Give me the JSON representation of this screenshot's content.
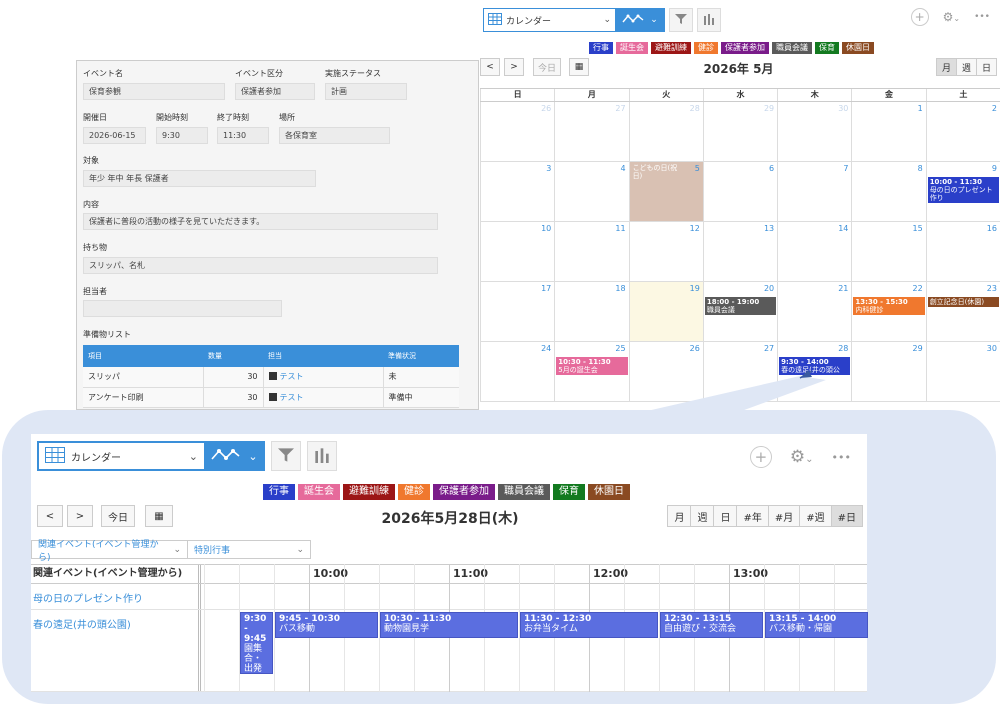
{
  "toolbar": {
    "view_label": "カレンダー",
    "caret": "⌄",
    "graph_icon": "∿∿",
    "filter_icon": "filter-icon",
    "chart_icon": "bar-chart-icon",
    "plus": "+",
    "gear": "⚙",
    "gear_caret": "⌄",
    "more": "•••"
  },
  "legend": [
    {
      "label": "行事",
      "color": "#2a3fc9"
    },
    {
      "label": "誕生会",
      "color": "#e66a9b"
    },
    {
      "label": "避難訓練",
      "color": "#9c1616"
    },
    {
      "label": "健診",
      "color": "#f0782e"
    },
    {
      "label": "保護者参加",
      "color": "#7a1c8a"
    },
    {
      "label": "職員会議",
      "color": "#5a5a5a"
    },
    {
      "label": "保育",
      "color": "#137a20"
    },
    {
      "label": "休園日",
      "color": "#8a4a22"
    }
  ],
  "month_view": {
    "prev": "<",
    "next": ">",
    "today": "今日",
    "calendar_icon": "▦",
    "title": "2026年 5月",
    "modes": [
      "月",
      "週",
      "日"
    ],
    "weekdays": [
      "日",
      "月",
      "火",
      "水",
      "木",
      "金",
      "土"
    ],
    "weeks": [
      [
        {
          "n": "26",
          "o": true
        },
        {
          "n": "27",
          "o": true
        },
        {
          "n": "28",
          "o": true
        },
        {
          "n": "29",
          "o": true
        },
        {
          "n": "30",
          "o": true
        },
        {
          "n": "1"
        },
        {
          "n": "2"
        }
      ],
      [
        {
          "n": "3"
        },
        {
          "n": "4"
        },
        {
          "n": "5",
          "holiday": true
        },
        {
          "n": "6"
        },
        {
          "n": "7"
        },
        {
          "n": "8"
        },
        {
          "n": "9"
        }
      ],
      [
        {
          "n": "10"
        },
        {
          "n": "11"
        },
        {
          "n": "12"
        },
        {
          "n": "13"
        },
        {
          "n": "14"
        },
        {
          "n": "15"
        },
        {
          "n": "16"
        }
      ],
      [
        {
          "n": "17"
        },
        {
          "n": "18"
        },
        {
          "n": "19",
          "today": true
        },
        {
          "n": "20"
        },
        {
          "n": "21"
        },
        {
          "n": "22"
        },
        {
          "n": "23"
        }
      ],
      [
        {
          "n": "24"
        },
        {
          "n": "25"
        },
        {
          "n": "26"
        },
        {
          "n": "27"
        },
        {
          "n": "28"
        },
        {
          "n": "29"
        },
        {
          "n": "30"
        }
      ]
    ],
    "events": [
      {
        "week": 1,
        "day": 2,
        "time": "",
        "title": "こどもの日(祝日)",
        "color": "transparent",
        "text": "#fff"
      },
      {
        "week": 1,
        "day": 6,
        "time": "10:00 - 11:30",
        "title": "母の日のプレゼント作り",
        "color": "#2a3fc9",
        "text": "#fff"
      },
      {
        "week": 3,
        "day": 3,
        "time": "18:00 - 19:00",
        "title": "職員会議",
        "color": "#5a5a5a",
        "text": "#fff"
      },
      {
        "week": 3,
        "day": 5,
        "time": "13:30 - 15:30",
        "title": "内科健診",
        "color": "#f0782e",
        "text": "#fff"
      },
      {
        "week": 3,
        "day": 6,
        "time": "",
        "title": "創立記念日(休園)",
        "color": "#8a4a22",
        "text": "#fff"
      },
      {
        "week": 4,
        "day": 1,
        "time": "10:30 - 11:30",
        "title": "5月の誕生会",
        "color": "#e66a9b",
        "text": "#fff"
      },
      {
        "week": 4,
        "day": 4,
        "time": "9:30 - 14:00",
        "title": "春の遠足(井の頭公",
        "color": "#2a3fc9",
        "text": "#fff"
      }
    ]
  },
  "form": {
    "event_name_label": "イベント名",
    "event_name": "保育参観",
    "event_type_label": "イベント区分",
    "event_type": "保護者参加",
    "status_label": "実施ステータス",
    "status": "計画",
    "date_label": "開催日",
    "date": "2026-06-15",
    "start_label": "開始時刻",
    "start": "9:30",
    "end_label": "終了時刻",
    "end": "11:30",
    "place_label": "場所",
    "place": "各保育室",
    "target_label": "対象",
    "target": "年少  年中  年長  保護者",
    "content_label": "内容",
    "content": "保護者に普段の活動の様子を見ていただきます。",
    "items_label": "持ち物",
    "items": "スリッパ、名札",
    "person_label": "担当者",
    "person": "",
    "prep_label": "準備物リスト",
    "prep_headers": [
      "項目",
      "数量",
      "担当",
      "準備状況"
    ],
    "prep_rows": [
      {
        "item": "スリッパ",
        "qty": "30",
        "owner": "テスト",
        "status": "未"
      },
      {
        "item": "アンケート印刷",
        "qty": "30",
        "owner": "テスト",
        "status": "準備中"
      }
    ]
  },
  "day_view": {
    "prev": "<",
    "next": ">",
    "today": "今日",
    "calendar_icon": "▦",
    "title": "2026年5月28日(木)",
    "modes": [
      "月",
      "週",
      "日",
      "#年",
      "#月",
      "#週",
      "#日"
    ],
    "filter1": "関連イベント(イベント管理から)",
    "filter2": "特別行事",
    "corner": "関連イベント(イベント管理から)",
    "hours": [
      "10:00",
      "11:00",
      "12:00",
      "13:00"
    ],
    "rows": [
      {
        "label": "母の日のプレゼント作り"
      },
      {
        "label": "春の遠足(井の頭公園)"
      }
    ],
    "events": [
      {
        "time": "9:30 - 9:45",
        "title": "園集合・出発式",
        "start": 9.5,
        "end": 9.75,
        "narrow": true
      },
      {
        "time": "9:45 - 10:30",
        "title": "バス移動",
        "start": 9.75,
        "end": 10.5
      },
      {
        "time": "10:30 - 11:30",
        "title": "動物園見学",
        "start": 10.5,
        "end": 11.5
      },
      {
        "time": "11:30 - 12:30",
        "title": "お弁当タイム",
        "start": 11.5,
        "end": 12.5
      },
      {
        "time": "12:30 - 13:15",
        "title": "自由遊び・交流会",
        "start": 12.5,
        "end": 13.25
      },
      {
        "time": "13:15 - 14:00",
        "title": "バス移動・帰園",
        "start": 13.25,
        "end": 14.0
      }
    ]
  }
}
